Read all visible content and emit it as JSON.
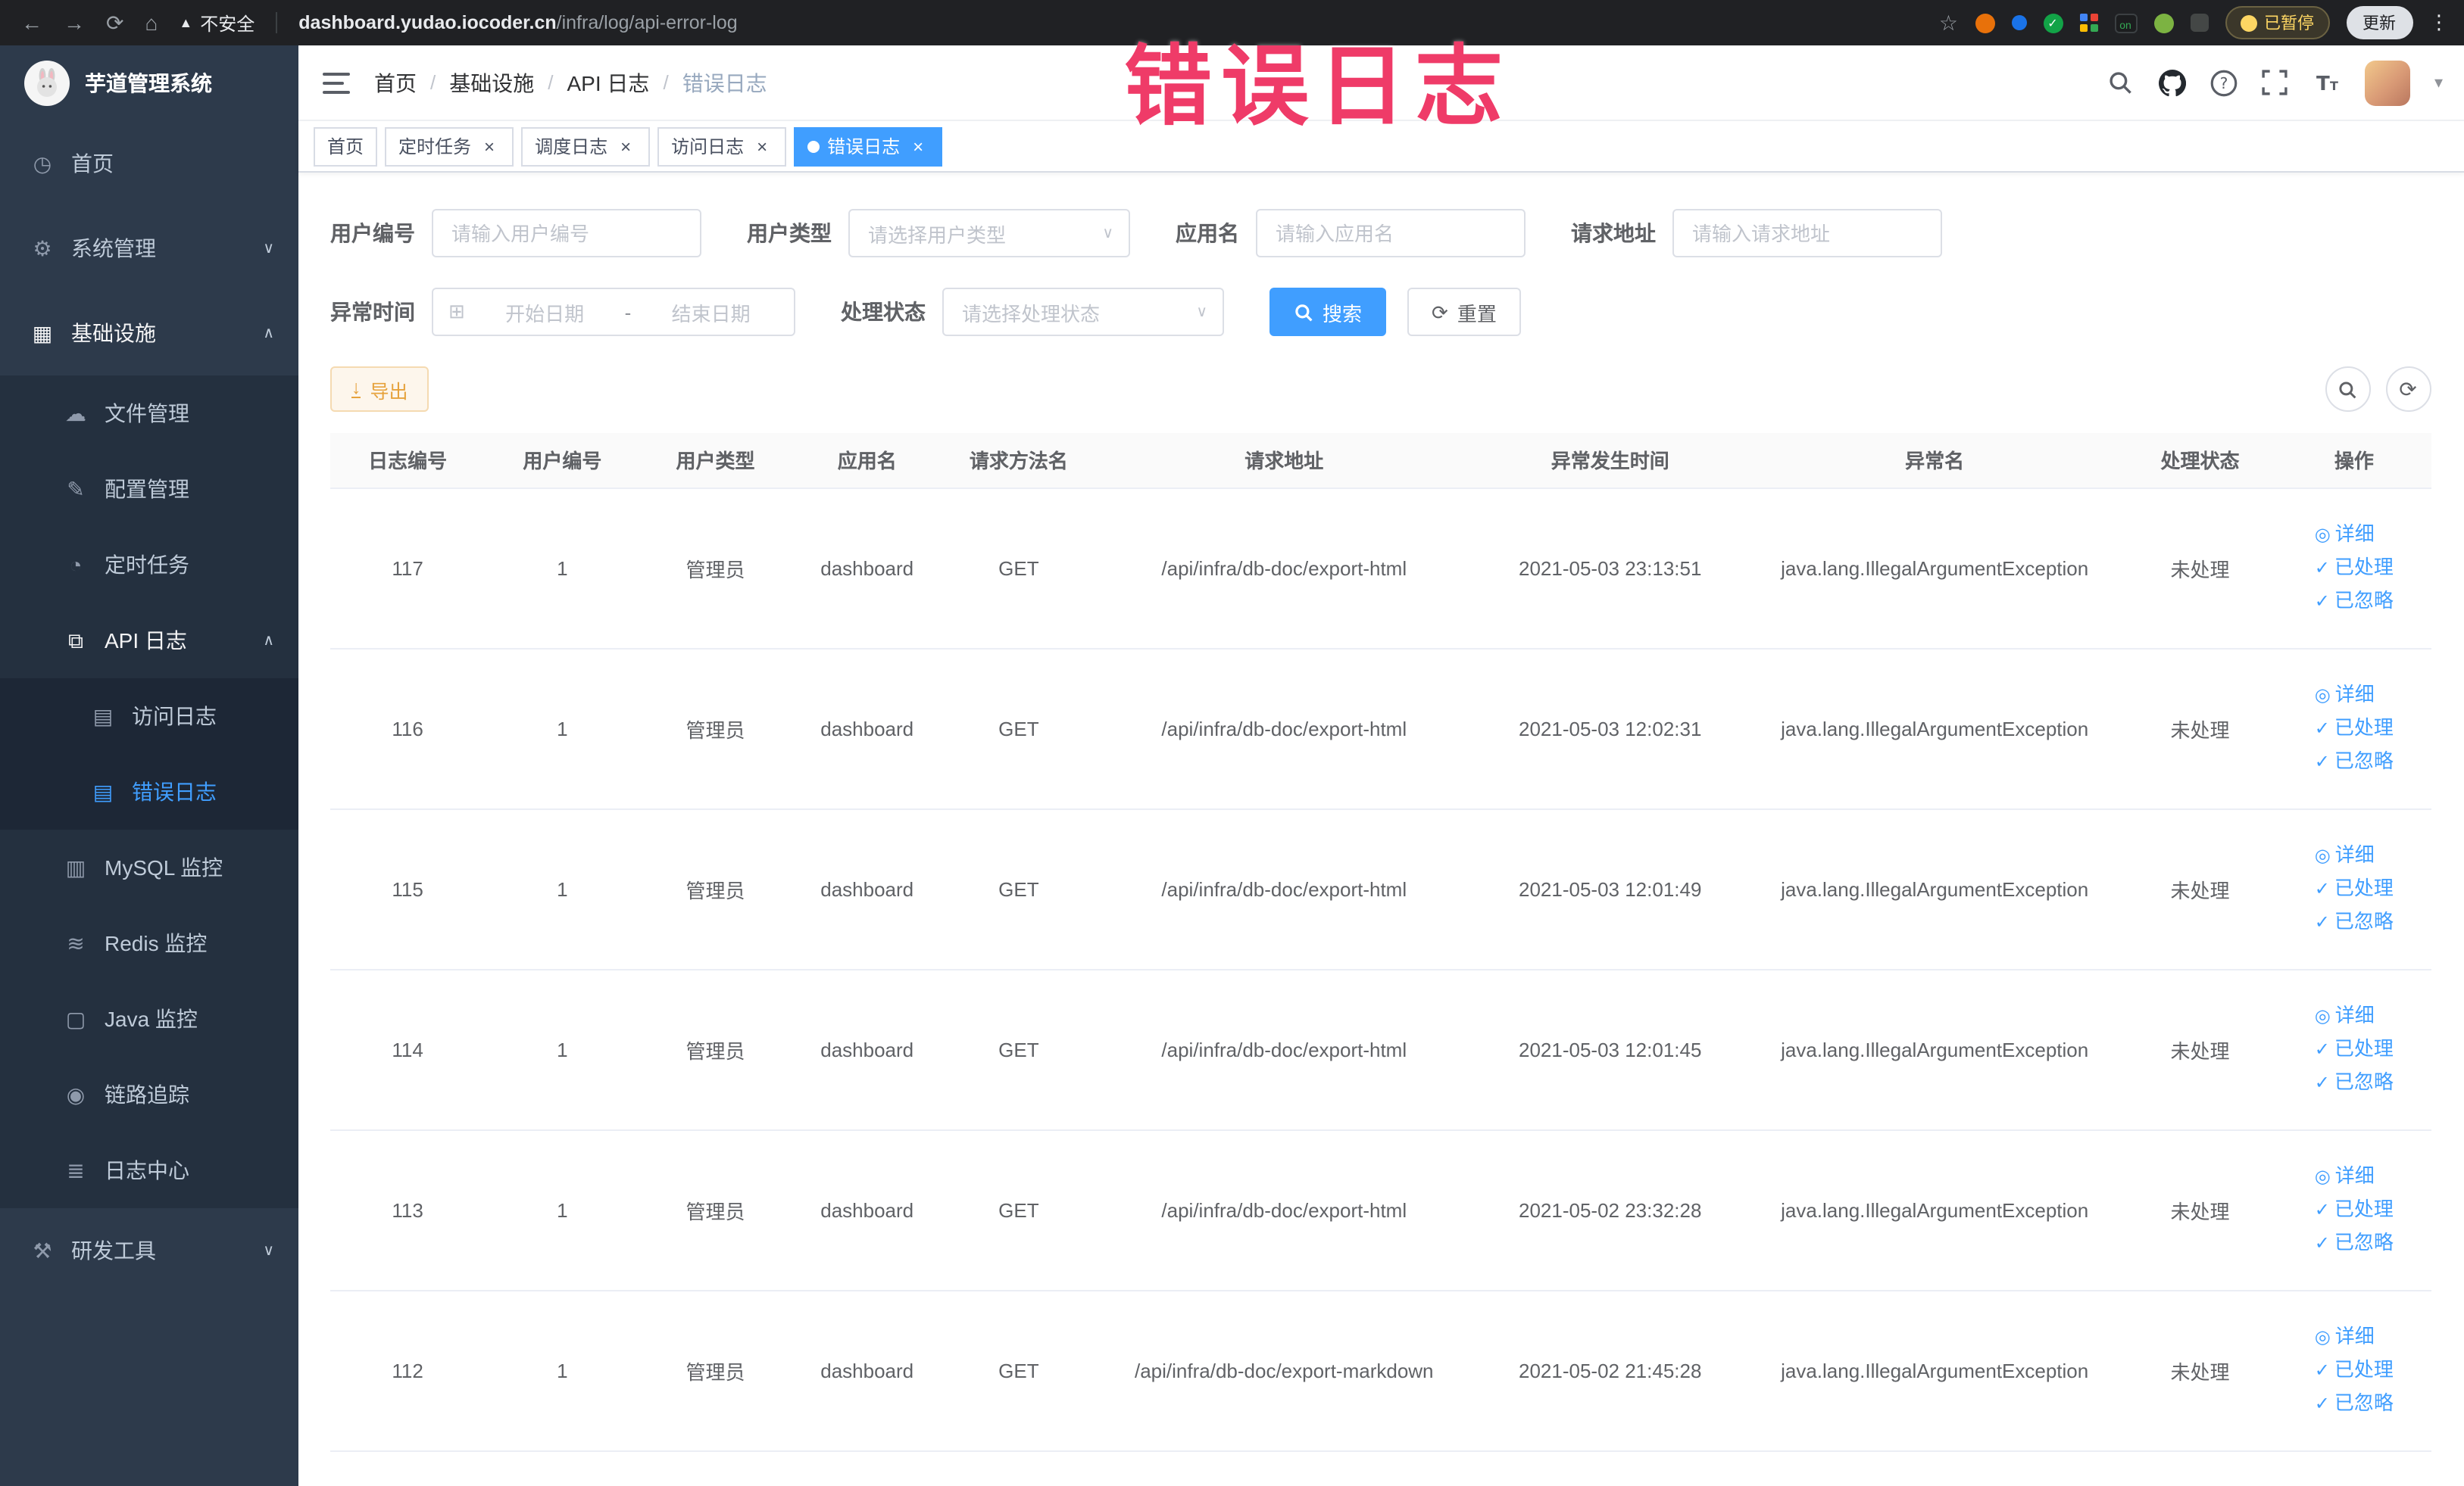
{
  "colors": {
    "primary": "#409eff",
    "warning": "#e6a23c",
    "warning_bg": "#fdf6ec",
    "warning_border": "#f5dab1",
    "overlay": "#ef3b68",
    "sidebar_bg": "#2d3a4b",
    "sidebar_sub": "#24303f",
    "sidebar_subsub": "#1d2736",
    "chrome_bg": "#202124"
  },
  "browser": {
    "security": "不安全",
    "url_host": "dashboard.yudao.iocoder.cn",
    "url_path": "/infra/log/api-error-log",
    "paused_label": "已暂停",
    "update_label": "更新",
    "on_badge": "on"
  },
  "overlay": {
    "text": "错误日志"
  },
  "icons": {
    "back": "←",
    "forward": "→",
    "reload": "⟳",
    "home": "⌂",
    "warning_triangle": "▲",
    "star": "☆",
    "kebab": "⋮",
    "dashboard": "◷",
    "gear": "⚙",
    "infrastructure": "▦",
    "cloud": "☁",
    "edit": "✎",
    "clock": "◔",
    "api_log": "⧉",
    "doc": "▤",
    "mysql": "▥",
    "redis": "≋",
    "monitor": "▢",
    "eye": "◉",
    "list": "≣",
    "tools": "⚒",
    "chevron_down": "∨",
    "chevron_up": "∧",
    "close": "×",
    "calendar": "⊞",
    "refresh": "⟳",
    "download": "↓",
    "detail": "◎",
    "check": "✓",
    "caret_down": "▾",
    "check_small": "✓"
  },
  "sidebar": {
    "logo_title": "芋道管理系统",
    "home": "首页",
    "system": "系统管理",
    "infrastructure": "基础设施",
    "file": "文件管理",
    "config": "配置管理",
    "job": "定时任务",
    "api_log": "API 日志",
    "access_log": "访问日志",
    "error_log": "错误日志",
    "mysql": "MySQL 监控",
    "redis": "Redis 监控",
    "java": "Java 监控",
    "trace": "链路追踪",
    "log_center": "日志中心",
    "dev_tools": "研发工具"
  },
  "navbar": {
    "breadcrumb": [
      "首页",
      "基础设施",
      "API 日志",
      "错误日志"
    ],
    "separator": "/"
  },
  "tabs": [
    {
      "label": "首页",
      "closable": false,
      "active": false
    },
    {
      "label": "定时任务",
      "closable": true,
      "active": false
    },
    {
      "label": "调度日志",
      "closable": true,
      "active": false
    },
    {
      "label": "访问日志",
      "closable": true,
      "active": false
    },
    {
      "label": "错误日志",
      "closable": true,
      "active": true
    }
  ],
  "filters": {
    "user_id_label": "用户编号",
    "user_id_placeholder": "请输入用户编号",
    "user_type_label": "用户类型",
    "user_type_placeholder": "请选择用户类型",
    "app_name_label": "应用名",
    "app_name_placeholder": "请输入应用名",
    "request_url_label": "请求地址",
    "request_url_placeholder": "请输入请求地址",
    "exception_time_label": "异常时间",
    "start_date_placeholder": "开始日期",
    "range_separator": "-",
    "end_date_placeholder": "结束日期",
    "process_status_label": "处理状态",
    "process_status_placeholder": "请选择处理状态",
    "search_button": "搜索",
    "reset_button": "重置"
  },
  "toolbar": {
    "export_label": "导出"
  },
  "table": {
    "columns": [
      "日志编号",
      "用户编号",
      "用户类型",
      "应用名",
      "请求方法名",
      "请求地址",
      "异常发生时间",
      "异常名",
      "处理状态",
      "操作"
    ],
    "actions": {
      "detail": "详细",
      "processed": "已处理",
      "ignored": "已忽略"
    },
    "rows": [
      {
        "id": "117",
        "user_id": "1",
        "user_type": "管理员",
        "app": "dashboard",
        "method": "GET",
        "url": "/api/infra/db-doc/export-html",
        "time": "2021-05-03 23:13:51",
        "exception": "java.lang.IllegalArgumentException",
        "status": "未处理"
      },
      {
        "id": "116",
        "user_id": "1",
        "user_type": "管理员",
        "app": "dashboard",
        "method": "GET",
        "url": "/api/infra/db-doc/export-html",
        "time": "2021-05-03 12:02:31",
        "exception": "java.lang.IllegalArgumentException",
        "status": "未处理"
      },
      {
        "id": "115",
        "user_id": "1",
        "user_type": "管理员",
        "app": "dashboard",
        "method": "GET",
        "url": "/api/infra/db-doc/export-html",
        "time": "2021-05-03 12:01:49",
        "exception": "java.lang.IllegalArgumentException",
        "status": "未处理"
      },
      {
        "id": "114",
        "user_id": "1",
        "user_type": "管理员",
        "app": "dashboard",
        "method": "GET",
        "url": "/api/infra/db-doc/export-html",
        "time": "2021-05-03 12:01:45",
        "exception": "java.lang.IllegalArgumentException",
        "status": "未处理"
      },
      {
        "id": "113",
        "user_id": "1",
        "user_type": "管理员",
        "app": "dashboard",
        "method": "GET",
        "url": "/api/infra/db-doc/export-html",
        "time": "2021-05-02 23:32:28",
        "exception": "java.lang.IllegalArgumentException",
        "status": "未处理"
      },
      {
        "id": "112",
        "user_id": "1",
        "user_type": "管理员",
        "app": "dashboard",
        "method": "GET",
        "url": "/api/infra/db-doc/export-markdown",
        "time": "2021-05-02 21:45:28",
        "exception": "java.lang.IllegalArgumentException",
        "status": "未处理"
      }
    ]
  }
}
